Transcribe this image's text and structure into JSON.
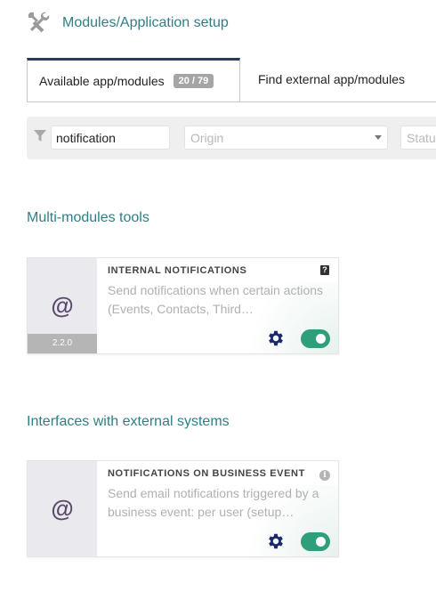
{
  "header": {
    "title": "Modules/Application setup",
    "icon": "tools-icon"
  },
  "tabs": [
    {
      "label": "Available app/modules",
      "badge": "20 / 79",
      "active": true
    },
    {
      "label": "Find external app/modules",
      "active": false
    }
  ],
  "filters": {
    "search_value": "notification",
    "origin_placeholder": "Origin",
    "status_placeholder": "Status"
  },
  "sections": [
    {
      "title": "Multi-modules tools",
      "cards": [
        {
          "title": "INTERNAL NOTIFICATIONS",
          "description": "Send notifications when certain actions (Events, Contacts, Third…",
          "version": "2.2.0",
          "logo": "@",
          "corner_icon": "help-icon",
          "enabled": true
        }
      ]
    },
    {
      "title": "Interfaces with external systems",
      "cards": [
        {
          "title": "NOTIFICATIONS ON BUSINESS EVENT",
          "description": "Send email notifications triggered by a business event: per user (setup…",
          "logo": "@",
          "corner_icon": "info-icon",
          "enabled": true
        }
      ]
    }
  ],
  "colors": {
    "accent_teal": "#2e7f86",
    "toggle_on": "#2f9e7b",
    "gear": "#1a2a6c",
    "active_tab_border": "#263c5c"
  }
}
